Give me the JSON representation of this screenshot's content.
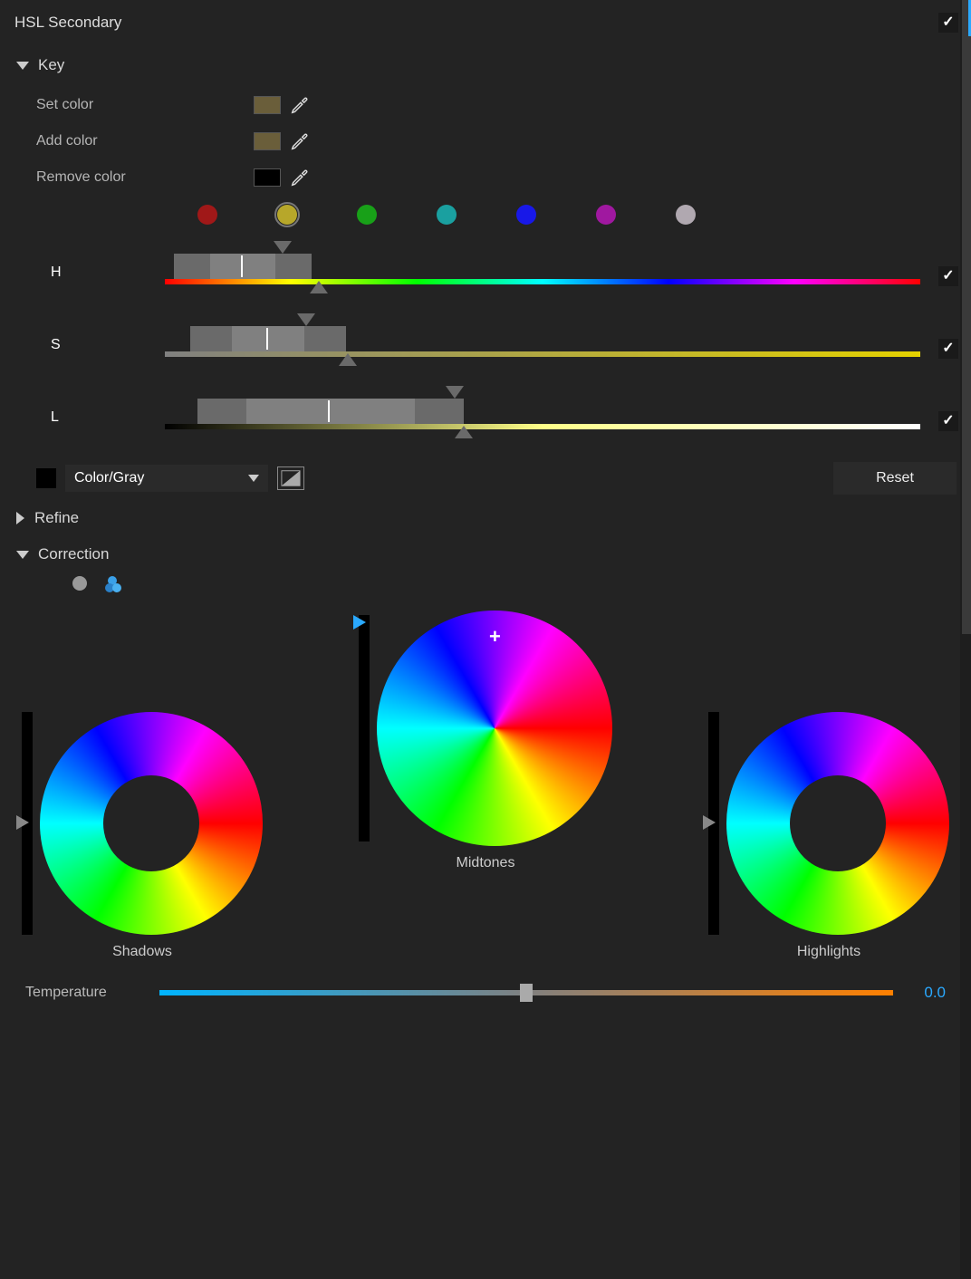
{
  "panel": {
    "title": "HSL Secondary",
    "enabled": true
  },
  "sections": {
    "key": {
      "title": "Key",
      "expanded": true
    },
    "refine": {
      "title": "Refine",
      "expanded": false
    },
    "correction": {
      "title": "Correction",
      "expanded": true
    }
  },
  "key": {
    "set": {
      "label": "Set color",
      "swatch": "#6a6140"
    },
    "add": {
      "label": "Add color",
      "swatch": "#6a6140"
    },
    "remove": {
      "label": "Remove color",
      "swatch": "#000000"
    },
    "presets": [
      {
        "color": "#a01818"
      },
      {
        "color": "#b7a72a",
        "selected": true
      },
      {
        "color": "#18a018"
      },
      {
        "color": "#1aa0a0"
      },
      {
        "color": "#1818e8"
      },
      {
        "color": "#a018a0"
      },
      {
        "color": "#b0a8b0"
      }
    ],
    "ranges": {
      "h": {
        "label": "H",
        "enabled": true
      },
      "s": {
        "label": "S",
        "enabled": true
      },
      "l": {
        "label": "L",
        "enabled": true
      }
    },
    "viewmode": {
      "checked": false,
      "dropdown": "Color/Gray"
    },
    "reset": "Reset"
  },
  "correction": {
    "wheels": {
      "shadows": "Shadows",
      "midtones": "Midtones",
      "highlights": "Highlights"
    }
  },
  "temperature": {
    "label": "Temperature",
    "value": "0.0",
    "position": 50
  }
}
